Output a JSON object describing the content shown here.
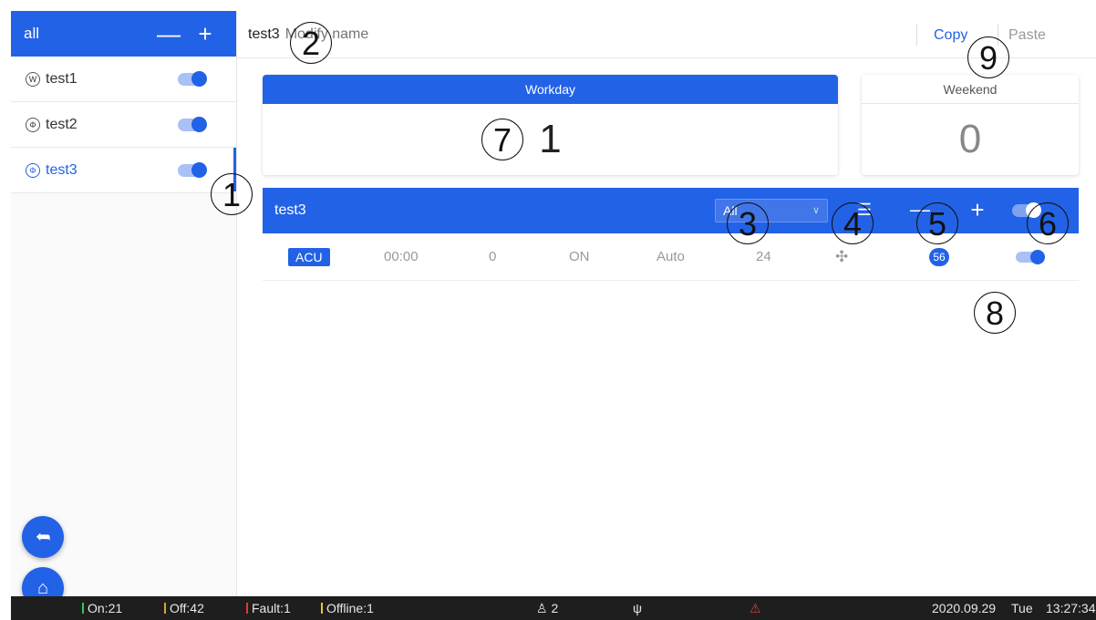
{
  "sidebar": {
    "header": {
      "title": "all",
      "minus": "—",
      "plus": "+"
    },
    "items": [
      {
        "label": "test1",
        "icon_glyph": "W"
      },
      {
        "label": "test2",
        "icon_glyph": "Φ"
      },
      {
        "label": "test3",
        "icon_glyph": "Φ"
      }
    ]
  },
  "topbar": {
    "name": "test3",
    "placeholder": "Modify name",
    "copy": "Copy",
    "paste": "Paste"
  },
  "cards": {
    "workday": {
      "label": "Workday",
      "value": "1"
    },
    "weekend": {
      "label": "Weekend",
      "value": "0"
    }
  },
  "group": {
    "name": "test3",
    "select_value": "All",
    "minus": "—",
    "plus": "+",
    "list_icon": "☰"
  },
  "row": {
    "badge": "ACU",
    "time": "00:00",
    "value": "0",
    "power": "ON",
    "mode": "Auto",
    "temp": "24",
    "fan_icon": "✣",
    "count": "56"
  },
  "callouts": [
    "1",
    "2",
    "3",
    "4",
    "5",
    "6",
    "7",
    "8",
    "9"
  ],
  "fabs": {
    "back": "➦",
    "home": "⌂"
  },
  "statusbar": {
    "on": "On:21",
    "off": "Off:42",
    "fault": "Fault:1",
    "offline": "Offline:1",
    "users": "2",
    "user_icon": "♙",
    "plug_icon": "ψ",
    "warn_icon": "⚠",
    "date": "2020.09.29",
    "weekday": "Tue",
    "time": "13:27:34"
  },
  "colors": {
    "accent": "#2262e6",
    "on": "#35c25a",
    "off": "#e0a030",
    "fault": "#e53935",
    "offline": "#f2c12e"
  }
}
